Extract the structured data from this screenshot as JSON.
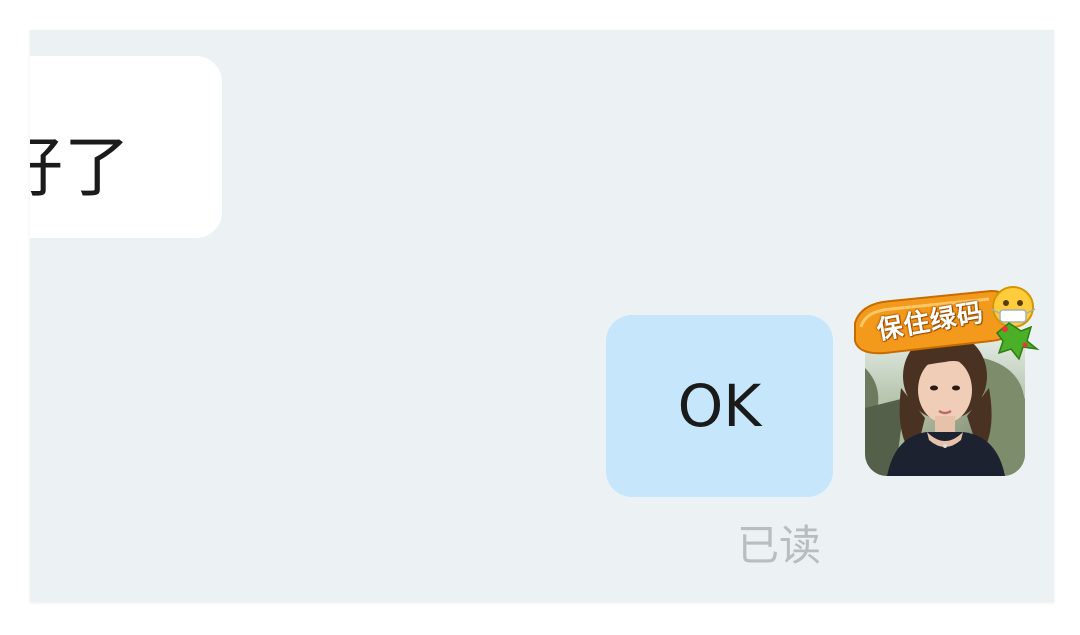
{
  "messages": {
    "incoming_text": "好了",
    "outgoing_text": "OK",
    "read_status": "已读"
  },
  "avatar": {
    "badge_text": "保住绿码"
  },
  "colors": {
    "panel_background": "#ecf1f3",
    "incoming_bubble": "#ffffff",
    "outgoing_bubble": "#c5e6fb",
    "read_status_text": "#b8bdc0",
    "badge_orange": "#f39a1c"
  }
}
